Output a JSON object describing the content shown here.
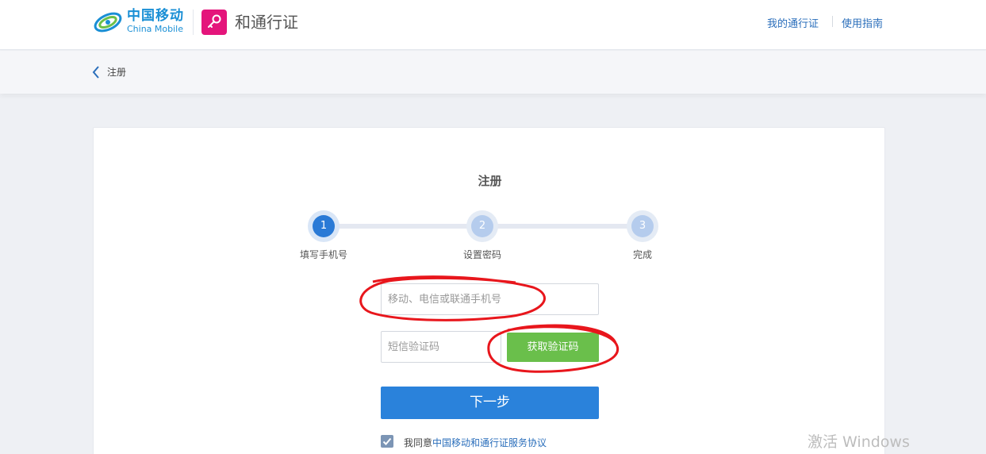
{
  "header": {
    "brand_cn": "中国移动",
    "brand_en": "China Mobile",
    "product": "和通行证",
    "links": [
      "我的通行证",
      "使用指南"
    ]
  },
  "breadcrumb": {
    "label": "注册"
  },
  "form": {
    "title": "注册",
    "steps": [
      {
        "num": "1",
        "label": "填写手机号"
      },
      {
        "num": "2",
        "label": "设置密码"
      },
      {
        "num": "3",
        "label": "完成"
      }
    ],
    "phone_placeholder": "移动、电信或联通手机号",
    "sms_placeholder": "短信验证码",
    "get_code_label": "获取验证码",
    "next_label": "下一步",
    "agree_prefix": "我同意",
    "agree_link": "中国移动和通行证服务协议"
  },
  "watermark": "激活 Windows",
  "colors": {
    "primary": "#2a82db",
    "success": "#6abf4b",
    "brand_pink": "#e4157b",
    "brand_blue": "#1a8fd5",
    "annotation": "#e8161c"
  }
}
